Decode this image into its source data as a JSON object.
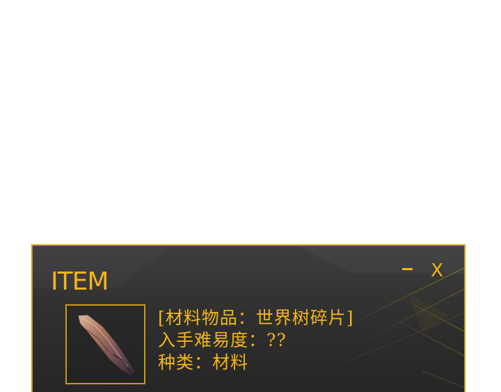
{
  "panel": {
    "title": "ITEM",
    "controls": {
      "minimize_icon": "minus-icon",
      "close_label": "X"
    },
    "item": {
      "icon": "world-tree-fragment-icon",
      "lines": [
        "[材料物品：世界树碎片]",
        "入手难易度：??",
        "种类：材料"
      ]
    }
  },
  "colors": {
    "accent": "#f5b51a",
    "border": "#c99a16",
    "panel_background": "#333333",
    "page_background": "#ffffff"
  }
}
